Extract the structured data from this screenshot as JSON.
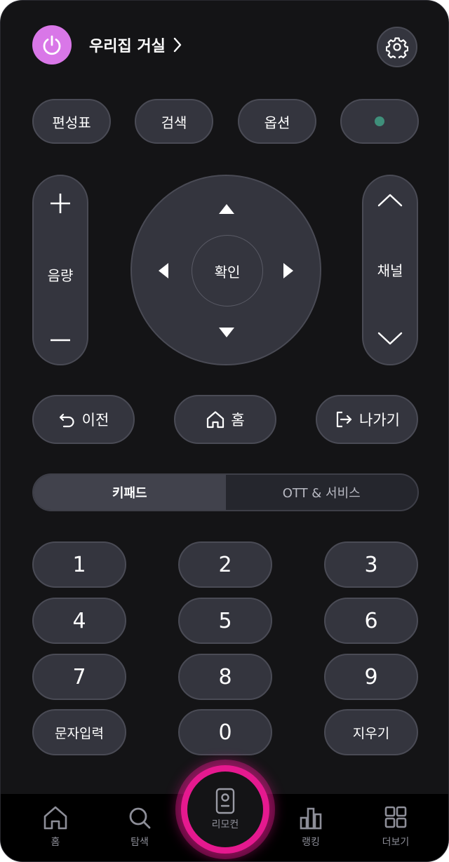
{
  "header": {
    "room_name": "우리집 거실",
    "power_icon": "power-icon",
    "settings_icon": "gear-icon"
  },
  "colors": {
    "background": "#141416",
    "button": "#34353e",
    "power": "#d977e8",
    "indicator": "#3f8f7a",
    "accent_ring": "#e5198f"
  },
  "top_buttons": {
    "guide": "편성표",
    "search": "검색",
    "options": "옵션"
  },
  "volume": {
    "label": "음량"
  },
  "dpad": {
    "ok": "확인"
  },
  "channel": {
    "label": "채널"
  },
  "mid_buttons": {
    "back": "이전",
    "home": "홈",
    "exit": "나가기"
  },
  "tabs": {
    "keypad": "키패드",
    "ott": "OTT & 서비스"
  },
  "keypad": {
    "k1": "1",
    "k2": "2",
    "k3": "3",
    "k4": "4",
    "k5": "5",
    "k6": "6",
    "k7": "7",
    "k8": "8",
    "k9": "9",
    "text_input": "문자입력",
    "k0": "0",
    "delete": "지우기"
  },
  "bottom_nav": {
    "home": "홈",
    "explore": "탐색",
    "remote": "리모컨",
    "ranking": "랭킹",
    "more": "더보기"
  }
}
